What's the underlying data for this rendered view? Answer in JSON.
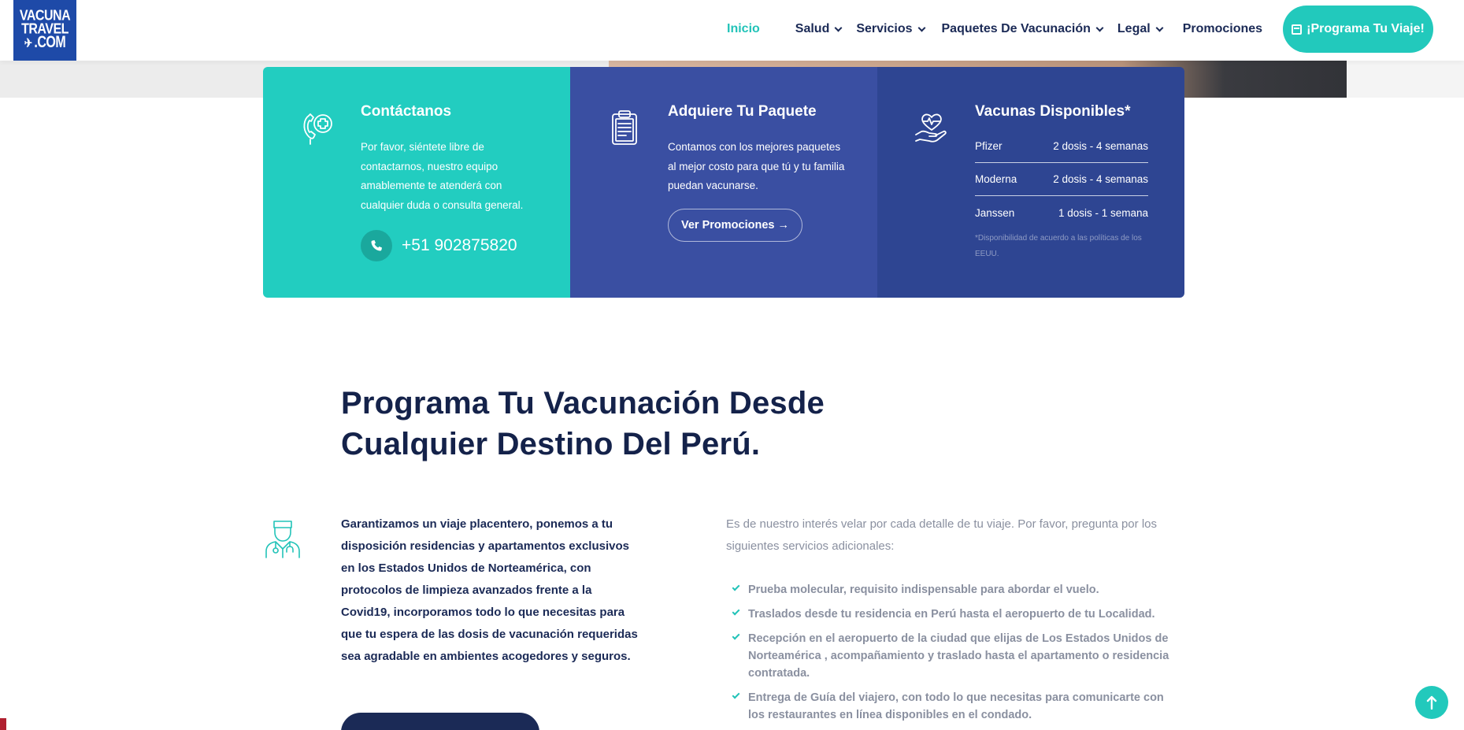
{
  "logo": {
    "line1": "VACUNA",
    "line2": "TRAVEL",
    "line3": ".COM",
    "color": "#1e4aa8"
  },
  "nav": {
    "items": [
      {
        "label": "Inicio",
        "active": true,
        "dropdown": false
      },
      {
        "label": "Salud",
        "active": false,
        "dropdown": true
      },
      {
        "label": "Servicios",
        "active": false,
        "dropdown": true
      },
      {
        "label": "Paquetes De Vacunación",
        "active": false,
        "dropdown": true
      },
      {
        "label": "Legal",
        "active": false,
        "dropdown": true
      },
      {
        "label": "Promociones",
        "active": false,
        "dropdown": false
      }
    ],
    "cta_label": "¡Programa Tu Viaje!",
    "accent": "#22c9bc"
  },
  "cards": {
    "contact": {
      "title": "Contáctanos",
      "text": "Por favor, siéntete libre de contactarnos, nuestro equipo amablemente te atenderá con cualquier duda o consulta general.",
      "phone": "+51 902875820",
      "color": "#22cdc0",
      "icon": "phone-medical-icon"
    },
    "package": {
      "title": "Adquiere Tu Paquete",
      "text": "Contamos con los mejores paquetes al mejor costo para que tú y tu familia puedan vacunarse.",
      "button_label": "Ver Promociones →",
      "color": "#3a4fa2",
      "icon": "clipboard-icon"
    },
    "vaccines": {
      "title": "Vacunas Disponibles*",
      "rows": [
        {
          "name": "Pfizer",
          "dose": "2 dosis - 4 semanas"
        },
        {
          "name": "Moderna",
          "dose": "2 dosis - 4 semanas"
        },
        {
          "name": "Janssen",
          "dose": "1 dosis - 1 semana"
        }
      ],
      "note": "*Disponibilidad de acuerdo a las políticas de los EEUU.",
      "color": "#2e4592",
      "icon": "heart-hand-icon"
    }
  },
  "main": {
    "headline": "Programa Tu Vacunación Desde Cualquier Destino Del Perú.",
    "lead": "Garantizamos un viaje placentero, ponemos a tu disposición residencias y apartamentos exclusivos en los Estados Unidos de Norteamérica, con protocolos de limpieza avanzados frente a la Covid19, incorporamos todo lo que necesitas para que tu espera de las dosis de vacunación requeridas sea agradable en ambientes acogedores y seguros.",
    "intro": "Es de nuestro interés velar por cada detalle de tu viaje. Por favor, pregunta por los siguientes servicios adicionales:",
    "services": [
      "Prueba molecular, requisito indispensable para abordar el vuelo.",
      "Traslados desde tu residencia en Perú hasta el aeropuerto de tu Localidad.",
      "Recepción en el aeropuerto de la ciudad que elijas de Los Estados Unidos de Norteamérica , acompañamiento y traslado hasta el apartamento o residencia contratada.",
      "Entrega de Guía del viajero, con todo lo que necesitas para comunicarte con los restaurantes en línea disponibles en el condado."
    ],
    "doctor_icon": "doctor-icon"
  }
}
